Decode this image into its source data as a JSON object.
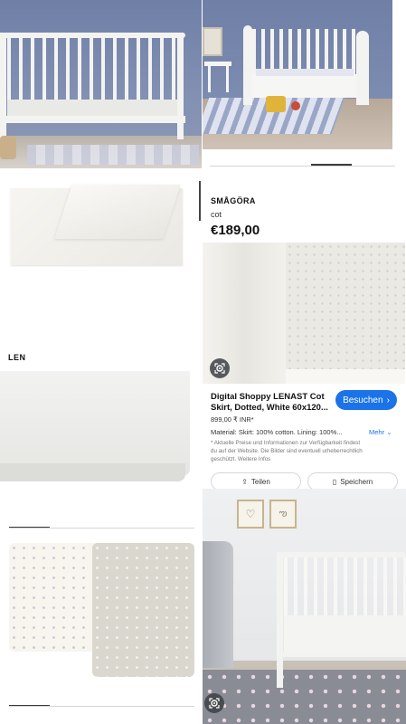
{
  "top_images": {
    "left_alt": "",
    "right_alt": ""
  },
  "len_label": "LEN",
  "product": {
    "name": "SMÅGÖRA",
    "type": "cot",
    "price": "€189,00"
  },
  "lens_result": {
    "title_line1": "Digital Shoppy LENAST Cot",
    "title_line2": "Skirt, Dotted, White 60x120...",
    "price": "899,00 ₹ INR*",
    "material": "Material: Skirt: 100% cotton. Lining: 100%...",
    "more_label": "Mehr",
    "disclaimer_line1": "* Aktuelle Preise und Informationen zur Verfügbarkeit findest",
    "disclaimer_line2": "du auf der Website. Die Bilder sind eventuell urheberrechtlich",
    "disclaimer_line3": "geschützt. Weitere Infos",
    "visit_button": "Besuchen",
    "share_button": "Teilen",
    "save_button": "Speichern"
  },
  "colors": {
    "accent_blue": "#1a73e8",
    "wall_blue": "#7a88ad"
  },
  "icons": [
    "lens-icon",
    "chevron-right-icon",
    "chevron-down-icon",
    "share-icon",
    "bookmark-icon"
  ]
}
